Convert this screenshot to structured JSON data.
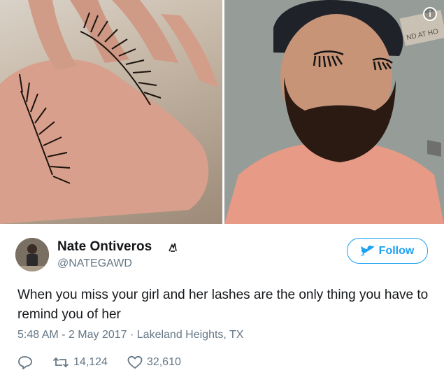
{
  "tweet": {
    "author": {
      "name": "Nate Ontiveros",
      "handle": "@NATEGAWD",
      "badge_icon": "bird-icon"
    },
    "follow_label": "Follow",
    "text": "When you miss your girl and her lashes are the only thing you have to remind you of her",
    "time": "5:48 AM - 2 May 2017",
    "separator": "·",
    "location": "Lakeland Heights, TX",
    "retweets": "14,124",
    "likes": "32,610"
  },
  "media": {
    "info_icon": "i",
    "sign_text": "ND AT HO"
  },
  "colors": {
    "accent": "#1da1f2",
    "secondary_text": "#657786",
    "primary_text": "#14171a"
  }
}
